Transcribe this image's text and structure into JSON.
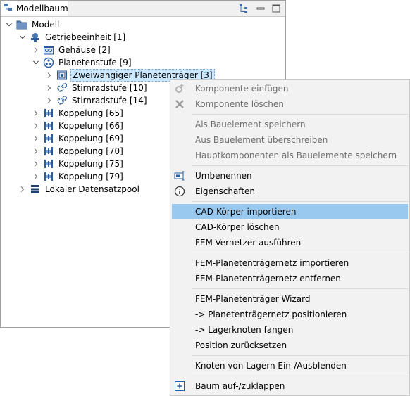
{
  "panel": {
    "tab_title": "Modellbaum",
    "tools": [
      "hierarchy-icon",
      "minimize-icon",
      "maximize-icon"
    ]
  },
  "tree": [
    {
      "label": "Modell",
      "level": 0,
      "expanded": true,
      "icon": "folder-icon"
    },
    {
      "label": "Getriebeeinheit [1]",
      "level": 1,
      "expanded": true,
      "icon": "gear-unit-icon"
    },
    {
      "label": "Gehäuse [2]",
      "level": 2,
      "expanded": false,
      "icon": "housing-icon"
    },
    {
      "label": "Planetenstufe [9]",
      "level": 2,
      "expanded": true,
      "icon": "planetary-stage-icon"
    },
    {
      "label": "Zweiwangiger Planetenträger [3]",
      "level": 3,
      "expanded": false,
      "icon": "planet-carrier-icon",
      "selected": true
    },
    {
      "label": "Stirnradstufe [10]",
      "level": 3,
      "expanded": false,
      "icon": "gear-stage-icon"
    },
    {
      "label": "Stirnradstufe [14]",
      "level": 3,
      "expanded": false,
      "icon": "gear-stage-icon"
    },
    {
      "label": "Koppelung [65]",
      "level": 2,
      "expanded": false,
      "icon": "coupling-icon"
    },
    {
      "label": "Koppelung [66]",
      "level": 2,
      "expanded": false,
      "icon": "coupling-icon"
    },
    {
      "label": "Koppelung [69]",
      "level": 2,
      "expanded": false,
      "icon": "coupling-icon"
    },
    {
      "label": "Koppelung [70]",
      "level": 2,
      "expanded": false,
      "icon": "coupling-icon"
    },
    {
      "label": "Koppelung [75]",
      "level": 2,
      "expanded": false,
      "icon": "coupling-icon"
    },
    {
      "label": "Koppelung [79]",
      "level": 2,
      "expanded": false,
      "icon": "coupling-icon"
    },
    {
      "label": "Lokaler Datensatzpool",
      "level": 1,
      "expanded": false,
      "icon": "database-icon"
    }
  ],
  "menu": {
    "items": [
      {
        "label": "Komponente einfügen",
        "disabled": true,
        "icon": "insert-component-icon"
      },
      {
        "label": "Komponente löschen",
        "disabled": true,
        "icon": "delete-icon"
      },
      {
        "sep": true
      },
      {
        "label": "Als Bauelement speichern",
        "disabled": true
      },
      {
        "label": "Aus Bauelement überschreiben",
        "disabled": true
      },
      {
        "label": "Hauptkomponenten als Bauelemente speichern",
        "disabled": true
      },
      {
        "sep": true
      },
      {
        "label": "Umbenennen",
        "icon": "rename-icon"
      },
      {
        "label": "Eigenschaften",
        "icon": "info-icon"
      },
      {
        "sep": true
      },
      {
        "label": "CAD-Körper importieren",
        "highlighted": true
      },
      {
        "label": "CAD-Körper löschen"
      },
      {
        "label": "FEM-Vernetzer ausführen"
      },
      {
        "sep": true
      },
      {
        "label": "FEM-Planetenträgernetz importieren"
      },
      {
        "label": "FEM-Planetenträgernetz entfernen"
      },
      {
        "sep": true
      },
      {
        "label": "FEM-Planetenträger Wizard"
      },
      {
        "label": "->  Planetenträgernetz positionieren"
      },
      {
        "label": "->  Lagerknoten fangen"
      },
      {
        "label": "Position zurücksetzen"
      },
      {
        "sep": true
      },
      {
        "label": "Knoten von Lagern Ein-/Ausblenden"
      },
      {
        "sep": true
      },
      {
        "label": "Baum auf-/zuklappen",
        "icon": "expand-collapse-icon"
      }
    ]
  },
  "colors": {
    "selection": "#cce8ff",
    "menu_highlight": "#99c9ef",
    "disabled_text": "#6d6d6d",
    "icon_blue": "#2a5b9c"
  }
}
